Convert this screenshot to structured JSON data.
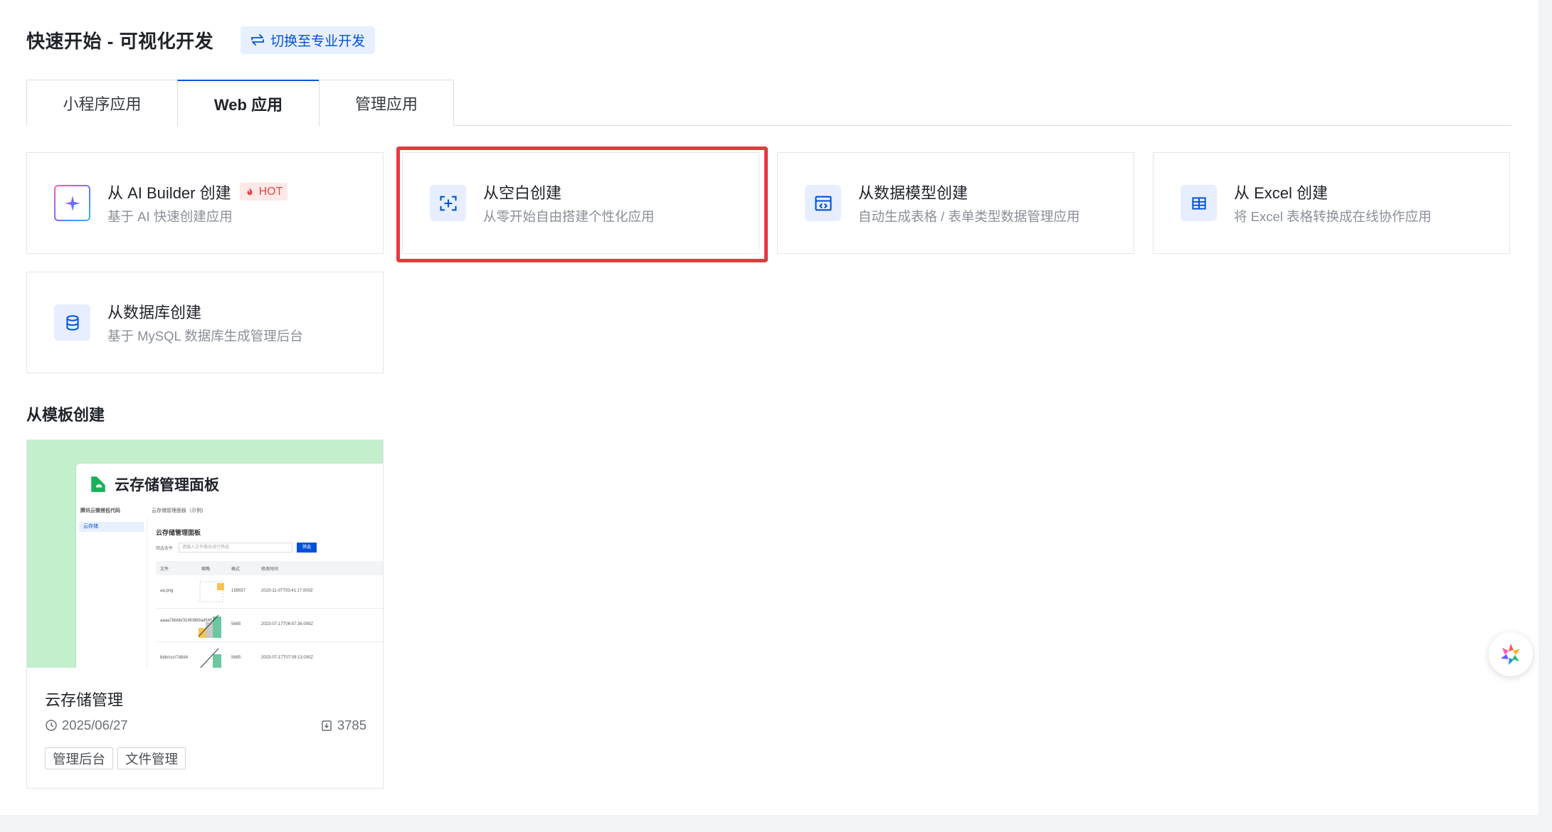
{
  "header": {
    "title": "快速开始 - 可视化开发",
    "switch_label": "切换至专业开发"
  },
  "tabs": [
    {
      "label": "小程序应用",
      "active": false
    },
    {
      "label": "Web 应用",
      "active": true
    },
    {
      "label": "管理应用",
      "active": false
    }
  ],
  "create_options": [
    {
      "title": "从 AI Builder 创建",
      "badge": "HOT",
      "desc": "基于 AI 快速创建应用",
      "icon": "sparkle-icon"
    },
    {
      "title": "从空白创建",
      "desc": "从零开始自由搭建个性化应用",
      "icon": "blank-frame-plus-icon",
      "selected": true
    },
    {
      "title": "从数据模型创建",
      "desc": "自动生成表格 / 表单类型数据管理应用",
      "icon": "data-model-icon"
    },
    {
      "title": "从 Excel 创建",
      "desc": "将 Excel 表格转换成在线协作应用",
      "icon": "table-grid-icon"
    },
    {
      "title": "从数据库创建",
      "desc": "基于 MySQL 数据库生成管理后台",
      "icon": "database-icon"
    }
  ],
  "templates_section": {
    "title": "从模板创建",
    "items": [
      {
        "name": "云存储管理",
        "date": "2025/06/27",
        "count": "3785",
        "tags": [
          "管理后台",
          "文件管理"
        ],
        "preview": {
          "title": "云存储管理面板",
          "topbar_brand": "腾讯云微搭低代码",
          "topbar_path": "云存储管理面板（示例）",
          "side_item": "云存储",
          "heading": "云存储管理面板",
          "filter_label": "筛选条件",
          "filter_placeholder": "请输入文件路径进行筛选",
          "filter_button": "筛选",
          "columns": [
            "文件",
            "缩略",
            "格式",
            "修改时间"
          ],
          "rows": [
            {
              "file": "aa.png",
              "size": "159557",
              "time": "2023-11-07T03:41:17.000Z"
            },
            {
              "file": "aaaa7bbbb/31f40869ad545...",
              "size": "5685",
              "time": "2023-07-17T06:57:36.000Z"
            },
            {
              "file": "bbb/ccc/7d8d4",
              "size": "5685",
              "time": "2023-07-17T07:09:13.000Z"
            }
          ]
        }
      }
    ]
  },
  "colors": {
    "primary": "#0052d9",
    "selected_border": "#e8383d",
    "hot_text": "#e5484d",
    "thumb_bg": "#c3efcc"
  }
}
